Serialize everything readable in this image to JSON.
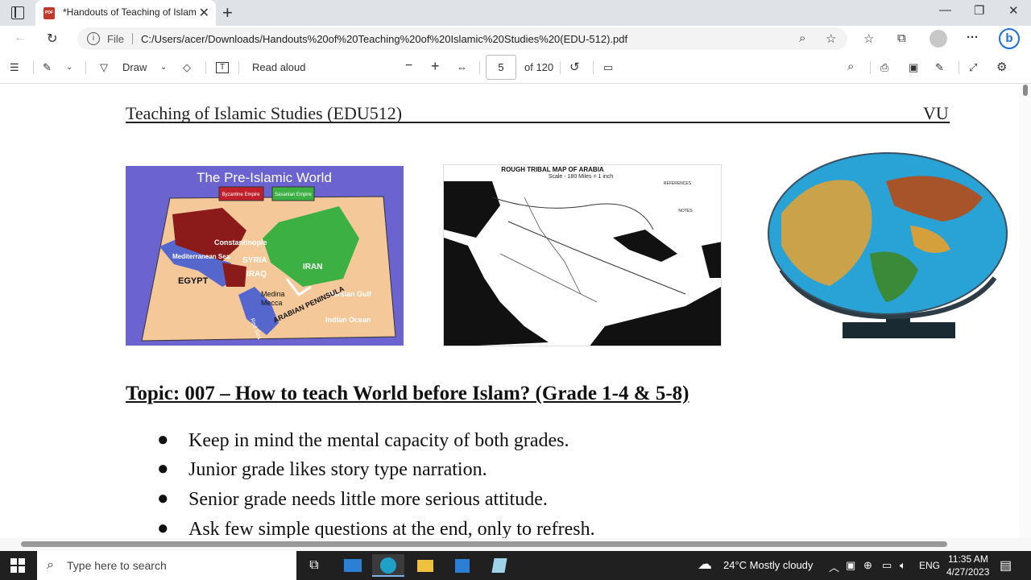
{
  "browser": {
    "tab_title": "*Handouts of Teaching of Islamic",
    "favicon_label": "PDF",
    "file_label": "File",
    "url": "C:/Users/acer/Downloads/Handouts%20of%20Teaching%20of%20Islamic%20Studies%20(EDU-512).pdf"
  },
  "pdf_toolbar": {
    "draw_label": "Draw",
    "read_aloud_label": "Read aloud",
    "page_current": "5",
    "page_total": "of 120"
  },
  "document": {
    "header_left": "Teaching of Islamic Studies (EDU512)",
    "header_right": "VU",
    "map1": {
      "title": "The Pre-Islamic World",
      "legend_byzantine": "Byzantine Empire",
      "legend_sasanian": "Sasanian Empire",
      "labels": {
        "constantinople": "Constantinople",
        "mediterranean": "Mediterranean Sea",
        "syria": "SYRIA",
        "iran": "IRAN",
        "iraq": "IRAQ",
        "egypt": "EGYPT",
        "medina": "Medina",
        "mecca": "Mecca",
        "persian_gulf": "Persian Gulf",
        "arabian": "ARABIAN PENINSULA",
        "red_sea": "Red Sea",
        "indian_ocean": "Indian Ocean"
      }
    },
    "map2": {
      "title": "ROUGH TRIBAL MAP OF ARABIA",
      "scale": "Scale - 180 Miles = 1 inch",
      "references": "REFERENCES",
      "notes": "NOTES"
    },
    "topic": "Topic: 007 – How to teach World before Islam? (Grade 1-4 & 5-8)",
    "bullets": [
      "Keep in mind the mental capacity of both grades.",
      "Junior grade likes story type narration.",
      "Senior grade needs little more serious attitude.",
      "Ask few simple questions at the end, only to refresh."
    ]
  },
  "taskbar": {
    "search_placeholder": "Type here to search",
    "weather": "24°C  Mostly cloudy",
    "language": "ENG",
    "time": "11:35 AM",
    "date": "4/27/2023"
  }
}
